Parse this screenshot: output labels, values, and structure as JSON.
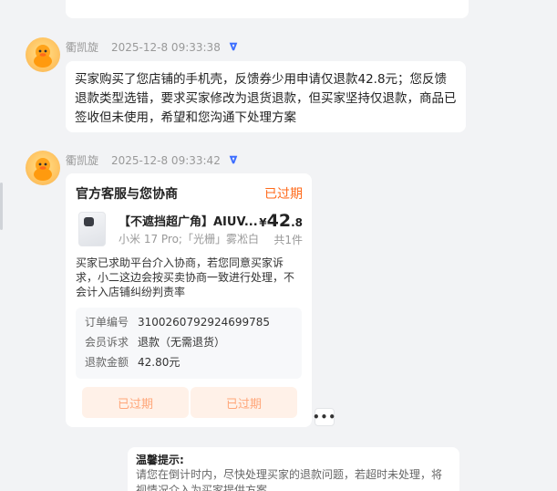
{
  "messages": [
    {
      "sender": "衢凯旋",
      "time": "2025-12-8 09:33:38",
      "text": "买家购买了您店铺的手机壳，反馈券少用申请仅退款42.8元；您反馈退款类型选错，要求买家修改为退货退款，但买家坚持仅退款，商品已签收但未使用，希望和您沟通下处理方案"
    },
    {
      "sender": "衢凯旋",
      "time": "2025-12-8 09:33:42"
    }
  ],
  "card": {
    "title": "官方客服与您协商",
    "status": "已过期",
    "product": {
      "name": "【不遮挡超广角】AIUV...",
      "spec": "小米 17 Pro;「光栅」雾凇白",
      "price_symbol": "¥",
      "price_int": "42",
      "price_dec": ".8",
      "quantity": "共1件"
    },
    "description": "买家已求助平台介入协商，若您同意买家诉求，小二这边会按买卖协商一致进行处理，不会计入店铺纠纷判责率",
    "info": [
      {
        "label": "订单编号",
        "value": "3100260792924699785"
      },
      {
        "label": "会员诉求",
        "value": "退款（无需退货）"
      },
      {
        "label": "退款金额",
        "value": "42.80元"
      }
    ],
    "buttons": [
      "已过期",
      "已过期"
    ]
  },
  "more_label": "•••",
  "tip": {
    "title": "温馨提示:",
    "body": "请您在倒计时内，尽快处理买家的退款问题，若超时未处理，将视情况介入为买家提供方案"
  },
  "icons": {
    "avatar": "duck-avatar-icon",
    "verified": "shield-verified-icon",
    "more": "more-dots-icon"
  },
  "colors": {
    "accent": "#ff6a1a",
    "verified": "#3d6eff",
    "disabled_button_bg": "#fff1e8",
    "disabled_button_text": "#ffa679"
  }
}
